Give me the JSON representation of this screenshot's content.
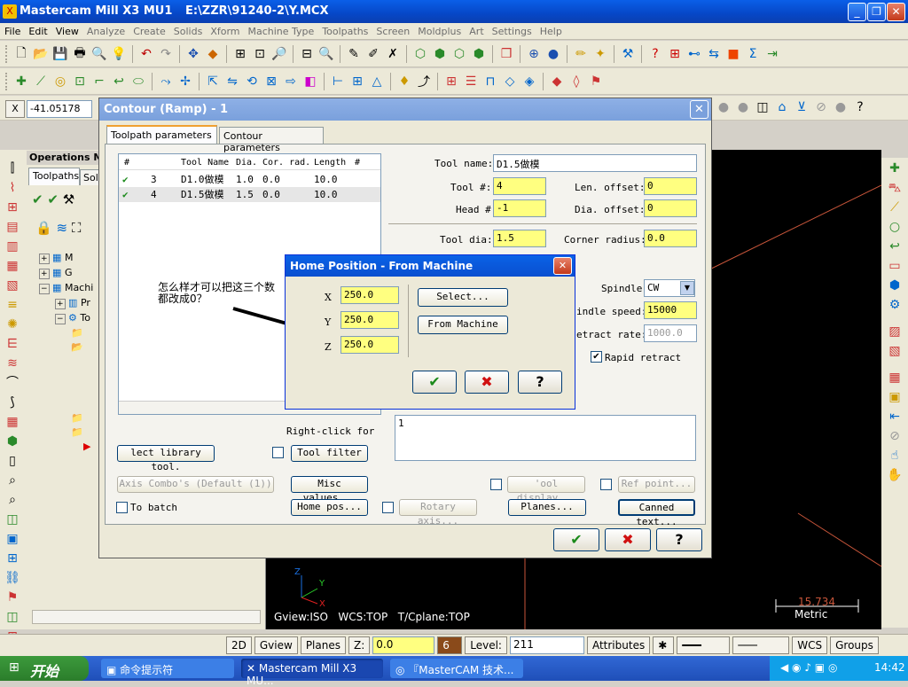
{
  "window": {
    "title": "Mastercam Mill X3 MU1",
    "file": "E:\\ZZR\\91240-2\\Y.MCX",
    "icon_name": "mastercam-icon"
  },
  "menu": [
    {
      "label": "File",
      "enabled": true
    },
    {
      "label": "Edit",
      "enabled": true
    },
    {
      "label": "View",
      "enabled": true
    },
    {
      "label": "Analyze",
      "enabled": false
    },
    {
      "label": "Create",
      "enabled": false
    },
    {
      "label": "Solids",
      "enabled": false
    },
    {
      "label": "Xform",
      "enabled": false
    },
    {
      "label": "Machine Type",
      "enabled": false
    },
    {
      "label": "Toolpaths",
      "enabled": false
    },
    {
      "label": "Screen",
      "enabled": false
    },
    {
      "label": "Moldplus",
      "enabled": false
    },
    {
      "label": "Art",
      "enabled": false
    },
    {
      "label": "Settings",
      "enabled": false
    },
    {
      "label": "Help",
      "enabled": false
    }
  ],
  "coord_bar": {
    "x_label": "X",
    "x_value": "-41.05178"
  },
  "operations": {
    "title": "Operations Ma",
    "tabs": [
      "Toolpaths",
      "Sol"
    ],
    "tree": [
      "M",
      "G",
      "Machi",
      "Pr",
      "To"
    ]
  },
  "dialog": {
    "title": "Contour (Ramp) - 1",
    "tabs": [
      "Toolpath parameters",
      "Contour parameters"
    ],
    "list_headers": [
      "#",
      "Tool Name",
      "Dia.",
      "Cor. rad.",
      "Length",
      "#"
    ],
    "tools": [
      {
        "num": "3",
        "name": "D1.0做模",
        "dia": "1.0",
        "cor": "0.0",
        "len": "10.0",
        "sel": false
      },
      {
        "num": "4",
        "name": "D1.5做模",
        "dia": "1.5",
        "cor": "0.0",
        "len": "10.0",
        "sel": true
      }
    ],
    "tool_name_label": "Tool name:",
    "tool_name": "D1.5做模",
    "tool_num_label": "Tool #:",
    "tool_num": "4",
    "len_offset_label": "Len. offset:",
    "len_offset": "0",
    "head_label": "Head #",
    "head": "-1",
    "dia_offset_label": "Dia. offset:",
    "dia_offset": "0",
    "tool_dia_label": "Tool dia:",
    "tool_dia": "1.5",
    "corner_label": "Corner radius:",
    "corner": "0.0",
    "spindle_label": "Spindle",
    "spindle": "CW",
    "spindle_speed_label": "indle speed:",
    "spindle_speed": "15000",
    "retract_label": "etract rate:",
    "retract": "1000.0",
    "rapid_label": "Rapid retract",
    "right_click": "Right-click for",
    "comment": "1",
    "library_btn": "lect library tool.",
    "filter_btn": "Tool filter",
    "axis_combo": "Axis Combo's (Default (1))",
    "misc_btn": "Misc values...",
    "tool_display_btn": "'ool display...",
    "ref_point_btn": "Ref point...",
    "to_batch": "To batch",
    "home_btn": "Home pos...",
    "rotary_btn": "Rotary axis...",
    "planes_btn": "Planes...",
    "canned_btn": "Canned text..."
  },
  "home": {
    "title": "Home Position - From Machine",
    "x_label": "X",
    "x": "250.0",
    "y_label": "Y",
    "y": "250.0",
    "z_label": "Z",
    "z": "250.0",
    "select_btn": "Select...",
    "from_machine_btn": "From Machine"
  },
  "annotation": {
    "line1": "怎么样才可以把这三个数",
    "line2": "都改成0？"
  },
  "graphics": {
    "gview": "Gview:ISO",
    "wcs": "WCS:TOP",
    "tcplane": "T/Cplane:TOP",
    "scale_value": "15.734",
    "scale_unit": "Metric"
  },
  "status": {
    "btn_2d": "2D",
    "gview": "Gview",
    "planes": "Planes",
    "z_label": "Z:",
    "z_value": "0.0",
    "color": "6",
    "level_label": "Level:",
    "level": "211",
    "attributes": "Attributes",
    "wcs": "WCS",
    "groups": "Groups"
  },
  "taskbar": {
    "start": "开始",
    "tasks": [
      "命令提示符",
      "Mastercam Mill X3 MU...",
      "『MasterCAM 技术..."
    ],
    "clock": "14:42"
  },
  "colors": {
    "accent_field": "#ffff80",
    "title_blue": "#0a5fe8"
  }
}
